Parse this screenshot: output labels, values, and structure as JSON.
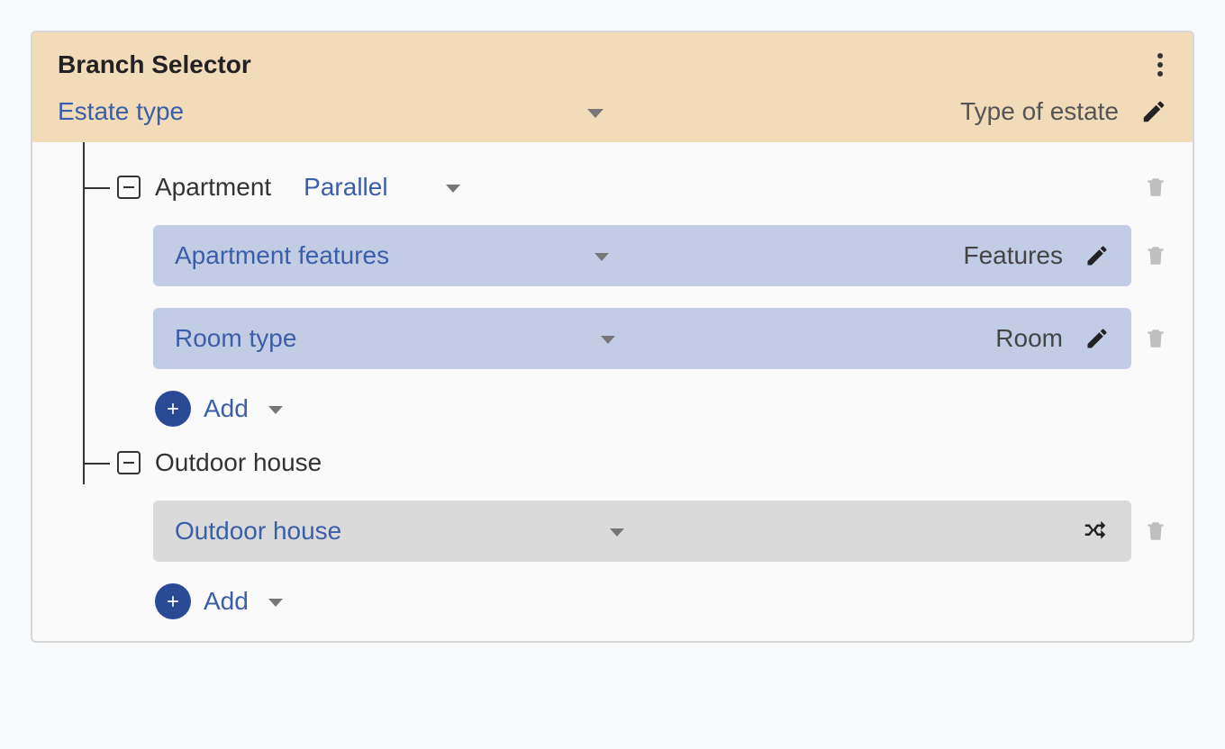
{
  "header": {
    "title": "Branch Selector",
    "dropdown_label": "Estate type",
    "display_label": "Type of estate"
  },
  "branches": [
    {
      "title": "Apartment",
      "mode": "Parallel",
      "children": [
        {
          "name": "Apartment features",
          "display": "Features",
          "action": "edit",
          "variant": "blue"
        },
        {
          "name": "Room type",
          "display": "Room",
          "action": "edit",
          "variant": "blue"
        }
      ],
      "add_label": "Add"
    },
    {
      "title": "Outdoor house",
      "mode": null,
      "children": [
        {
          "name": "Outdoor house",
          "display": null,
          "action": "shuffle",
          "variant": "grey"
        }
      ],
      "add_label": "Add"
    }
  ]
}
